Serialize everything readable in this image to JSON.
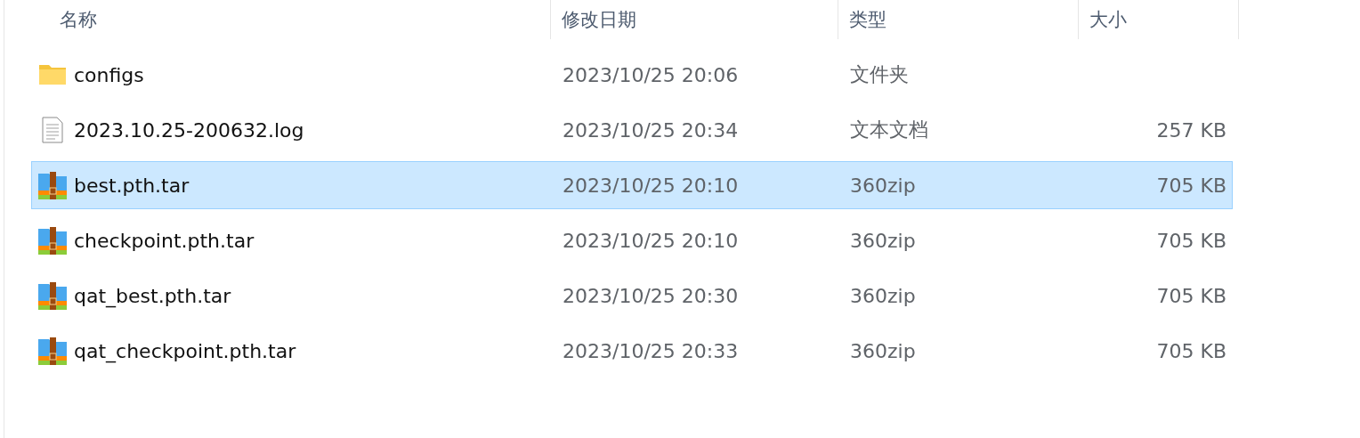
{
  "columns": [
    {
      "label": "名称"
    },
    {
      "label": "修改日期"
    },
    {
      "label": "类型"
    },
    {
      "label": "大小"
    }
  ],
  "files": [
    {
      "kind": "folder",
      "name": "configs",
      "modified": "2023/10/25 20:06",
      "type": "文件夹",
      "selected": false
    },
    {
      "kind": "text",
      "name": "2023.10.25-200632.log",
      "modified": "2023/10/25 20:34",
      "type": "文本文档",
      "size": "257 KB",
      "selected": false
    },
    {
      "kind": "archive",
      "name": "best.pth.tar",
      "modified": "2023/10/25 20:10",
      "type": "360zip",
      "size": "705 KB",
      "selected": true
    },
    {
      "kind": "archive",
      "name": "checkpoint.pth.tar",
      "modified": "2023/10/25 20:10",
      "type": "360zip",
      "size": "705 KB",
      "selected": false
    },
    {
      "kind": "archive",
      "name": "qat_best.pth.tar",
      "modified": "2023/10/25 20:30",
      "type": "360zip",
      "size": "705 KB",
      "selected": false
    },
    {
      "kind": "archive",
      "name": "qat_checkpoint.pth.tar",
      "modified": "2023/10/25 20:33",
      "type": "360zip",
      "size": "705 KB",
      "selected": false
    }
  ]
}
